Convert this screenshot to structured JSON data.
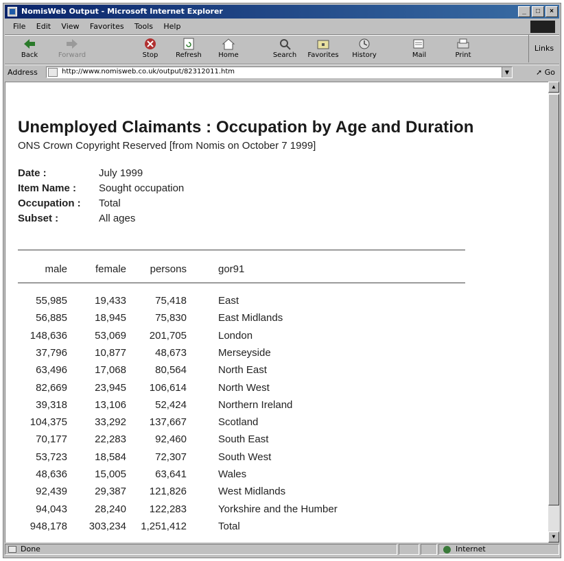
{
  "window": {
    "title": "NomisWeb Output - Microsoft Internet Explorer",
    "buttons": [
      "_",
      "□",
      "×"
    ]
  },
  "menu": [
    "File",
    "Edit",
    "View",
    "Favorites",
    "Tools",
    "Help"
  ],
  "toolbar": {
    "buttons": [
      {
        "label": "Back",
        "icon": "back-arrow-icon"
      },
      {
        "label": "Forward",
        "icon": "forward-arrow-icon"
      },
      {
        "label": "Stop",
        "icon": "stop-icon"
      },
      {
        "label": "Refresh",
        "icon": "refresh-icon"
      },
      {
        "label": "Home",
        "icon": "home-icon"
      },
      {
        "label": "Search",
        "icon": "search-icon"
      },
      {
        "label": "Favorites",
        "icon": "favorites-icon"
      },
      {
        "label": "History",
        "icon": "history-icon"
      },
      {
        "label": "Mail",
        "icon": "mail-icon"
      },
      {
        "label": "Print",
        "icon": "print-icon"
      }
    ],
    "links": "Links"
  },
  "address": {
    "label": "Address",
    "url": "http://www.nomisweb.co.uk/output/82312011.htm",
    "go": "Go"
  },
  "page": {
    "title": "Unemployed Claimants : Occupation by Age and Duration",
    "copyright": "ONS Crown Copyright Reserved [from Nomis on October 7 1999]",
    "meta": [
      {
        "key": "Date :",
        "value": "July 1999"
      },
      {
        "key": "Item Name :",
        "value": "Sought occupation"
      },
      {
        "key": "Occupation :",
        "value": "Total"
      },
      {
        "key": "Subset :",
        "value": "All ages"
      }
    ],
    "table": {
      "headers": [
        "male",
        "female",
        "persons",
        "gor91"
      ],
      "rows": [
        [
          "55,985",
          "19,433",
          "75,418",
          "East"
        ],
        [
          "56,885",
          "18,945",
          "75,830",
          "East Midlands"
        ],
        [
          "148,636",
          "53,069",
          "201,705",
          "London"
        ],
        [
          "37,796",
          "10,877",
          "48,673",
          "Merseyside"
        ],
        [
          "63,496",
          "17,068",
          "80,564",
          "North East"
        ],
        [
          "82,669",
          "23,945",
          "106,614",
          "North West"
        ],
        [
          "39,318",
          "13,106",
          "52,424",
          "Northern Ireland"
        ],
        [
          "104,375",
          "33,292",
          "137,667",
          "Scotland"
        ],
        [
          "70,177",
          "22,283",
          "92,460",
          "South East"
        ],
        [
          "53,723",
          "18,584",
          "72,307",
          "South West"
        ],
        [
          "48,636",
          "15,005",
          "63,641",
          "Wales"
        ],
        [
          "92,439",
          "29,387",
          "121,826",
          "West Midlands"
        ],
        [
          "94,043",
          "28,240",
          "122,283",
          "Yorkshire and the Humber"
        ],
        [
          "948,178",
          "303,234",
          "1,251,412",
          "Total"
        ]
      ]
    }
  },
  "status": {
    "text": "Done",
    "zone": "Internet"
  }
}
